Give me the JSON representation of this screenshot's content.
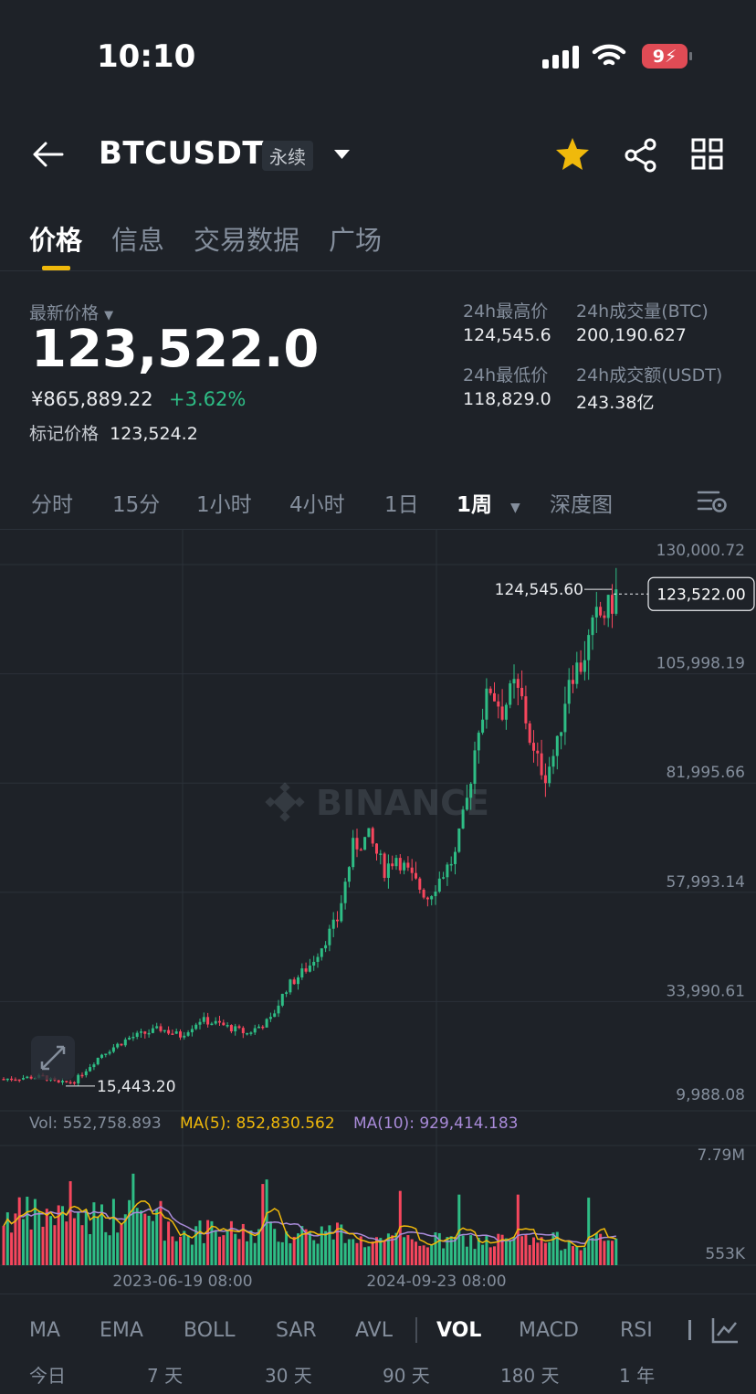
{
  "status": {
    "time": "10:10",
    "battery": "9"
  },
  "header": {
    "symbol": "BTCUSDT",
    "contract_type": "永续"
  },
  "tabs": [
    "价格",
    "信息",
    "交易数据",
    "广场"
  ],
  "ticker": {
    "last_label": "最新价格",
    "last_price": "123,522.0",
    "cny_price": "¥865,889.22",
    "change_pct": "+3.62%",
    "mark_label": "标记价格",
    "mark_price": "123,524.2",
    "high_label": "24h最高价",
    "high": "124,545.6",
    "low_label": "24h最低价",
    "low": "118,829.0",
    "vol_btc_label": "24h成交量(BTC)",
    "vol_btc": "200,190.627",
    "vol_usdt_label": "24h成交额(USDT)",
    "vol_usdt": "243.38亿"
  },
  "intervals": [
    "分时",
    "15分",
    "1小时",
    "4小时",
    "1日",
    "1周",
    "深度图"
  ],
  "active_interval": "1周",
  "chart_data": {
    "type": "candlestick",
    "watermark": "BINANCE",
    "y_axis_labels": [
      "130,000.72",
      "105,998.19",
      "81,995.66",
      "57,993.14",
      "33,990.61",
      "9,988.08"
    ],
    "ylim": [
      9988.08,
      130000.72
    ],
    "current_price_label": "123,522.00",
    "high_marker": "124,545.60",
    "low_marker": "15,443.20",
    "x_axis_labels": [
      "2023-06-19 08:00",
      "2024-09-23 08:00"
    ],
    "up_color": "#2ebd85",
    "down_color": "#f6465d",
    "volume": {
      "vol_label": "Vol: 552,758.893",
      "ma5_label": "MA(5): 852,830.562",
      "ma10_label": "MA(10): 929,414.183",
      "ma5_color": "#f0b90b",
      "ma10_color": "#a98bd9",
      "y_axis_labels": [
        "7.79M",
        "553K"
      ]
    }
  },
  "indicators": [
    "MA",
    "EMA",
    "BOLL",
    "SAR",
    "AVL",
    "VOL",
    "MACD",
    "RSI"
  ],
  "active_indicator": "VOL",
  "ranges": [
    "今日",
    "7 天",
    "30 天",
    "90 天",
    "180 天",
    "1 年"
  ]
}
